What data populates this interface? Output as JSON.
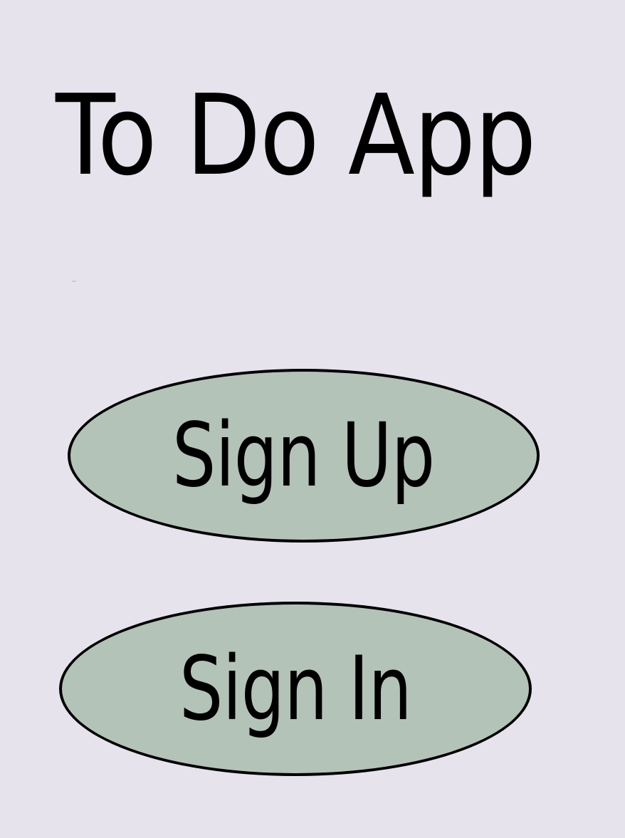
{
  "app": {
    "title": "To Do App"
  },
  "buttons": {
    "sign_up": "Sign Up",
    "sign_in": "Sign In"
  },
  "colors": {
    "background": "#e6e3ed",
    "button_fill": "#b3c3b8",
    "text": "#000000"
  }
}
